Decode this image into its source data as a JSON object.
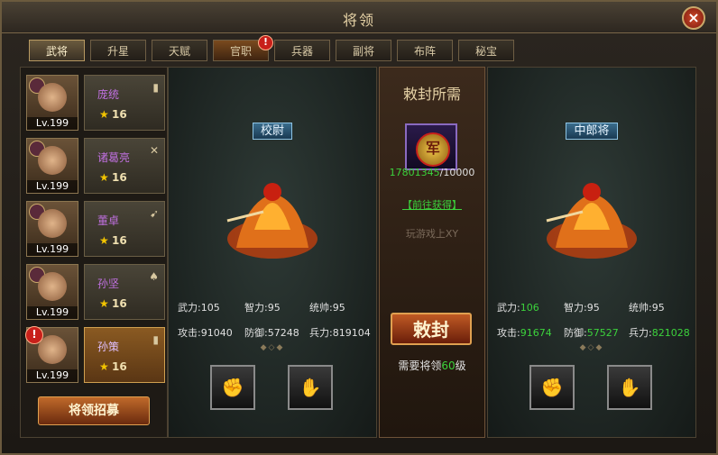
{
  "window": {
    "title": "将领",
    "close_icon": "close-icon"
  },
  "tabs": [
    {
      "label": "武将",
      "active": true
    },
    {
      "label": "升星"
    },
    {
      "label": "天赋"
    },
    {
      "label": "官职",
      "badge": "!"
    },
    {
      "label": "兵器"
    },
    {
      "label": "副将"
    },
    {
      "label": "布阵"
    },
    {
      "label": "秘宝"
    }
  ],
  "heroes": [
    {
      "name": "庞统",
      "level": "Lv.199",
      "stars": "16",
      "type_icon": "shield-icon"
    },
    {
      "name": "诸葛亮",
      "level": "Lv.199",
      "stars": "16",
      "type_icon": "crossed-swords-icon"
    },
    {
      "name": "董卓",
      "level": "Lv.199",
      "stars": "16",
      "type_icon": "spear-icon"
    },
    {
      "name": "孙坚",
      "level": "Lv.199",
      "stars": "16",
      "type_icon": "axe-icon"
    },
    {
      "name": "孙策",
      "level": "Lv.199",
      "stars": "16",
      "type_icon": "shield-icon",
      "selected": true,
      "badge": "!"
    }
  ],
  "recruit_button": "将领招募",
  "current": {
    "rank": "校尉",
    "stats": {
      "wuli_label": "武力:",
      "wuli": "105",
      "zhili_label": "智力:",
      "zhili": "95",
      "tongshuai_label": "统帅:",
      "tongshuai": "95",
      "gongji_label": "攻击:",
      "gongji": "91040",
      "fangyu_label": "防御:",
      "fangyu": "57248",
      "bingli_label": "兵力:",
      "bingli": "819104"
    }
  },
  "requirement": {
    "title": "敕封所需",
    "item_icon": "army-seal-icon",
    "item_glyph": "军",
    "have": "17801345",
    "need": "/10000",
    "link": "【前往获得】",
    "watermark": "玩游戏上XY",
    "promote_button": "敕封",
    "level_prefix": "需要将领",
    "level_value": "60",
    "level_suffix": "级"
  },
  "next": {
    "rank": "中郎将",
    "stats": {
      "wuli_label": "武力:",
      "wuli": "106",
      "zhili_label": "智力:",
      "zhili": "95",
      "tongshuai_label": "统帅:",
      "tongshuai": "95",
      "gongji_label": "攻击:",
      "gongji": "91674",
      "fangyu_label": "防御:",
      "fangyu": "57527",
      "bingli_label": "兵力:",
      "bingli": "821028"
    }
  }
}
